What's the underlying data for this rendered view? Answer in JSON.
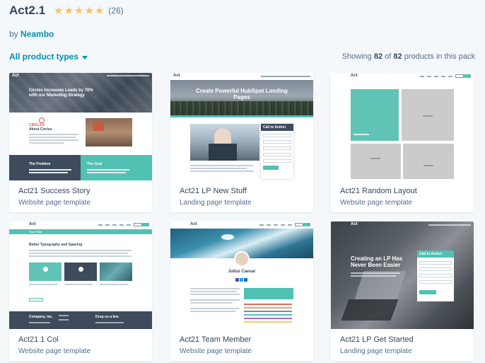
{
  "header": {
    "title": "Act2.1",
    "stars": [
      "★",
      "★",
      "★",
      "★",
      "★"
    ],
    "rating_count": "(26)",
    "by_prefix": "by",
    "author": "Neambo"
  },
  "filter": {
    "label": "All product types"
  },
  "showing": {
    "prefix": "Showing",
    "shown": "82",
    "of": "of",
    "total": "82",
    "suffix": "products in this pack"
  },
  "colors": {
    "accent": "#51c1b3",
    "link": "#0091ae",
    "dark_navy": "#3d4b5c",
    "star": "#f5c26b"
  },
  "cards": [
    {
      "name": "Act21 Success Story",
      "type": "Website page template",
      "preview": {
        "logo": "Act",
        "hero_text": "Circles Increases Leads by 70% with our Marketing Strategy",
        "about_label": "About Circles",
        "problem_label": "The Problem",
        "goal_label": "The Goal"
      }
    },
    {
      "name": "Act21 LP New Stuff",
      "type": "Landing page template",
      "preview": {
        "logo": "Act",
        "hero_text": "Create Powerful HubSpot Landing Pages",
        "form_title": "Call to Action"
      }
    },
    {
      "name": "Act21 Random Layout",
      "type": "Website page template",
      "preview": {
        "logo": "Act"
      }
    },
    {
      "name": "Act21 1 Col",
      "type": "Website page template",
      "preview": {
        "logo": "Act",
        "banner_text": "Your Title",
        "heading": "Better Typography and Spacing",
        "footer_company": "Company, Inc.",
        "footer_drop": "Drop us a line"
      }
    },
    {
      "name": "Act21 Team Member",
      "type": "Website page template",
      "preview": {
        "logo": "Act",
        "person_name": "Julius Caesar"
      }
    },
    {
      "name": "Act21 LP Get Started",
      "type": "Landing page template",
      "preview": {
        "logo": "Act",
        "hero_text": "Creating an LP Has Never Been Easier",
        "form_title": "Call to Action"
      }
    }
  ]
}
